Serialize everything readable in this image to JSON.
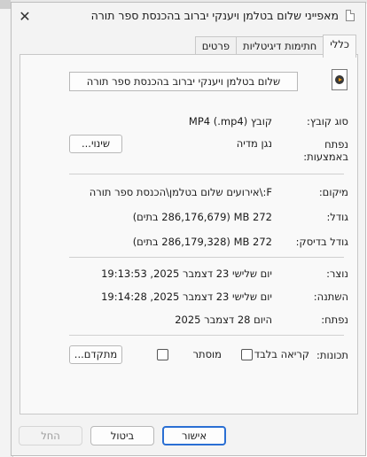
{
  "window": {
    "title": "מאפייני שלום בטלמן ויענקי יברוב בהכנסת ספר תורה",
    "close_symbol": "✕"
  },
  "tabs": [
    {
      "label": "כללי",
      "active": true
    },
    {
      "label": "חתימות דיגיטליות",
      "active": false
    },
    {
      "label": "פרטים",
      "active": false
    }
  ],
  "general": {
    "file_name": "שלום בטלמן ויענקי יברוב בהכנסת ספר תורה",
    "file_type_label": "סוג קובץ:",
    "file_type_value": "קובץ MP4 (.mp4)",
    "opens_with_label": "נפתח באמצעות:",
    "opens_with_value": "נגן מדיה",
    "change_button": "שינוי...",
    "location_label": "מיקום:",
    "location_value": "F:\\אירועים שלום בטלמן\\הכנסת ספר תורה",
    "size_label": "גודל:",
    "size_value": "272 MB ‏(286,176,679 בתים)",
    "size_on_disk_label": "גודל בדיסק:",
    "size_on_disk_value": "272 MB ‏(286,179,328 בתים)",
    "created_label": "נוצר:",
    "created_value": "יום שלישי 23 דצמבר 2025, 19:13:53",
    "modified_label": "השתנה:",
    "modified_value": "יום שלישי 23 דצמבר 2025, 19:14:28",
    "accessed_label": "נפתח:",
    "accessed_value": "היום 28 דצמבר 2025",
    "attributes_label": "תכונות:",
    "readonly_label": "קריאה בלבד",
    "readonly_checked": false,
    "hidden_label": "מוסתר",
    "hidden_checked": false,
    "advanced_button": "מתקדם..."
  },
  "footer": {
    "ok": "אישור",
    "cancel": "ביטול",
    "apply": "החל"
  },
  "icons": {
    "file": "media-file-icon",
    "title": "document-icon"
  }
}
